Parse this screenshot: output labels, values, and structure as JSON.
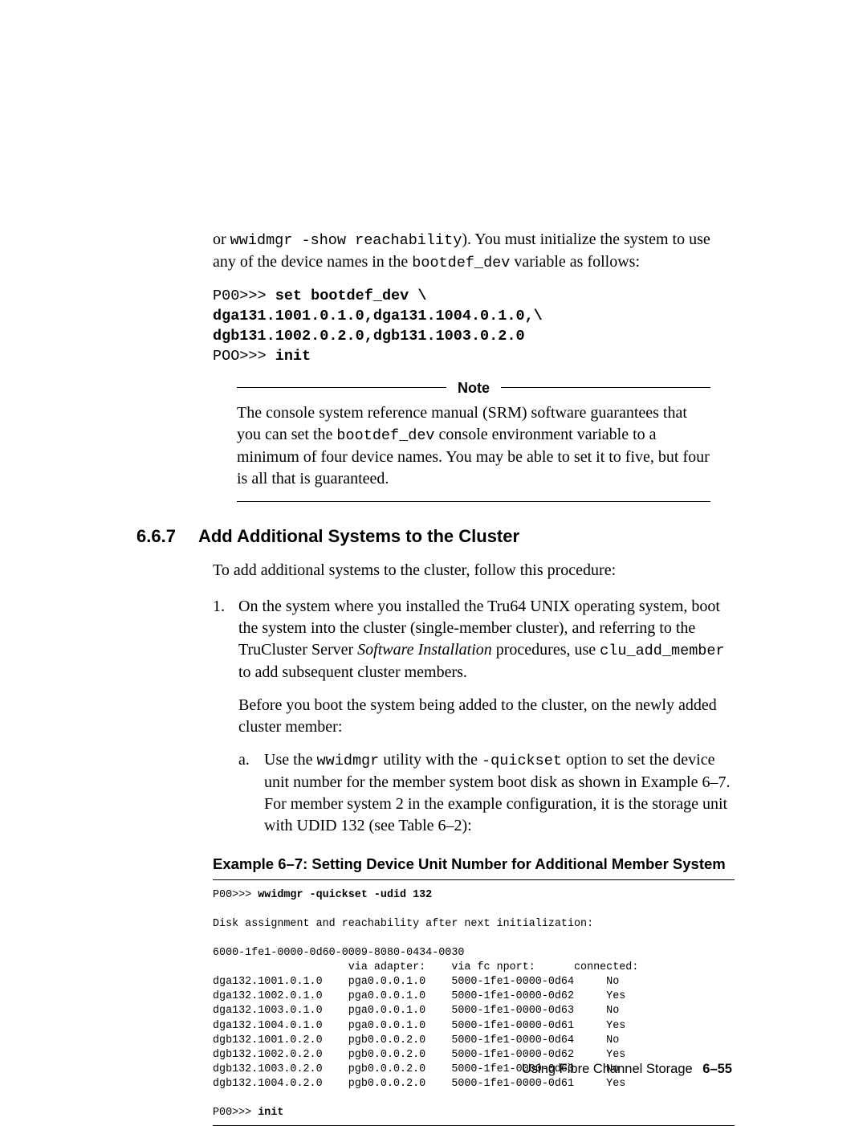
{
  "intro": {
    "text_a": "or ",
    "code_a": "wwidmgr -show reachability",
    "text_b": "). You must initialize the system to use any of the device names in the ",
    "code_b": "bootdef_dev",
    "text_c": " variable as follows:"
  },
  "codeblock1": {
    "l1_prompt": "P00>>> ",
    "l1_cmd": "set bootdef_dev \\",
    "l2_cmd": "dga131.1001.0.1.0,dga131.1004.0.1.0,\\",
    "l3_cmd": "dgb131.1002.0.2.0,dgb131.1003.0.2.0",
    "l4_prompt": "POO>>> ",
    "l4_cmd": "init"
  },
  "note": {
    "label": "Note",
    "body_a": "The console system reference manual (SRM) software guarantees that you can set the ",
    "body_code": "bootdef_dev",
    "body_b": " console environment variable to a minimum of four device names. You may be able to set it to five, but four is all that is guaranteed."
  },
  "section": {
    "num": "6.6.7",
    "title": "Add Additional Systems to the Cluster",
    "intro": "To add additional systems to the cluster, follow this procedure:"
  },
  "item1": {
    "num": "1.",
    "p1_a": "On the system where you installed the Tru64 UNIX operating system, boot the system into the cluster (single-member cluster), and referring to the TruCluster Server ",
    "p1_i": "Software Installation",
    "p1_b": " procedures, use ",
    "p1_code": "clu_add_member",
    "p1_c": " to add subsequent cluster members.",
    "p2": "Before you boot the system being added to the cluster, on the newly added cluster member:"
  },
  "sub_a": {
    "num": "a.",
    "t1": "Use the ",
    "c1": "wwidmgr",
    "t2": " utility with the ",
    "c2": "-quickset",
    "t3": " option to set the device unit number for the member system boot disk as shown in Example 6–7. For member system 2 in the example configuration, it is the storage unit with UDID 132 (see Table 6–2):"
  },
  "example": {
    "title": "Example 6–7: Setting Device Unit Number for Additional Member System",
    "l1_prompt": "P00>>> ",
    "l1_cmd": "wwidmgr -quickset -udid 132",
    "l2": "Disk assignment and reachability after next initialization:",
    "l3": "6000-1fe1-0000-0d60-0009-8080-0434-0030",
    "hdr": "                     via adapter:    via fc nport:      connected:",
    "r1": "dga132.1001.0.1.0    pga0.0.0.1.0    5000-1fe1-0000-0d64     No",
    "r2": "dga132.1002.0.1.0    pga0.0.0.1.0    5000-1fe1-0000-0d62     Yes",
    "r3": "dga132.1003.0.1.0    pga0.0.0.1.0    5000-1fe1-0000-0d63     No",
    "r4": "dga132.1004.0.1.0    pga0.0.0.1.0    5000-1fe1-0000-0d61     Yes",
    "r5": "dgb132.1001.0.2.0    pgb0.0.0.2.0    5000-1fe1-0000-0d64     No",
    "r6": "dgb132.1002.0.2.0    pgb0.0.0.2.0    5000-1fe1-0000-0d62     Yes",
    "r7": "dgb132.1003.0.2.0    pgb0.0.0.2.0    5000-1fe1-0000-0d63     No",
    "r8": "dgb132.1004.0.2.0    pgb0.0.0.2.0    5000-1fe1-0000-0d61     Yes",
    "l_end_prompt": "P00>>> ",
    "l_end_cmd": "init"
  },
  "footer": {
    "text": "Using Fibre Channel Storage",
    "page": "6–55"
  }
}
